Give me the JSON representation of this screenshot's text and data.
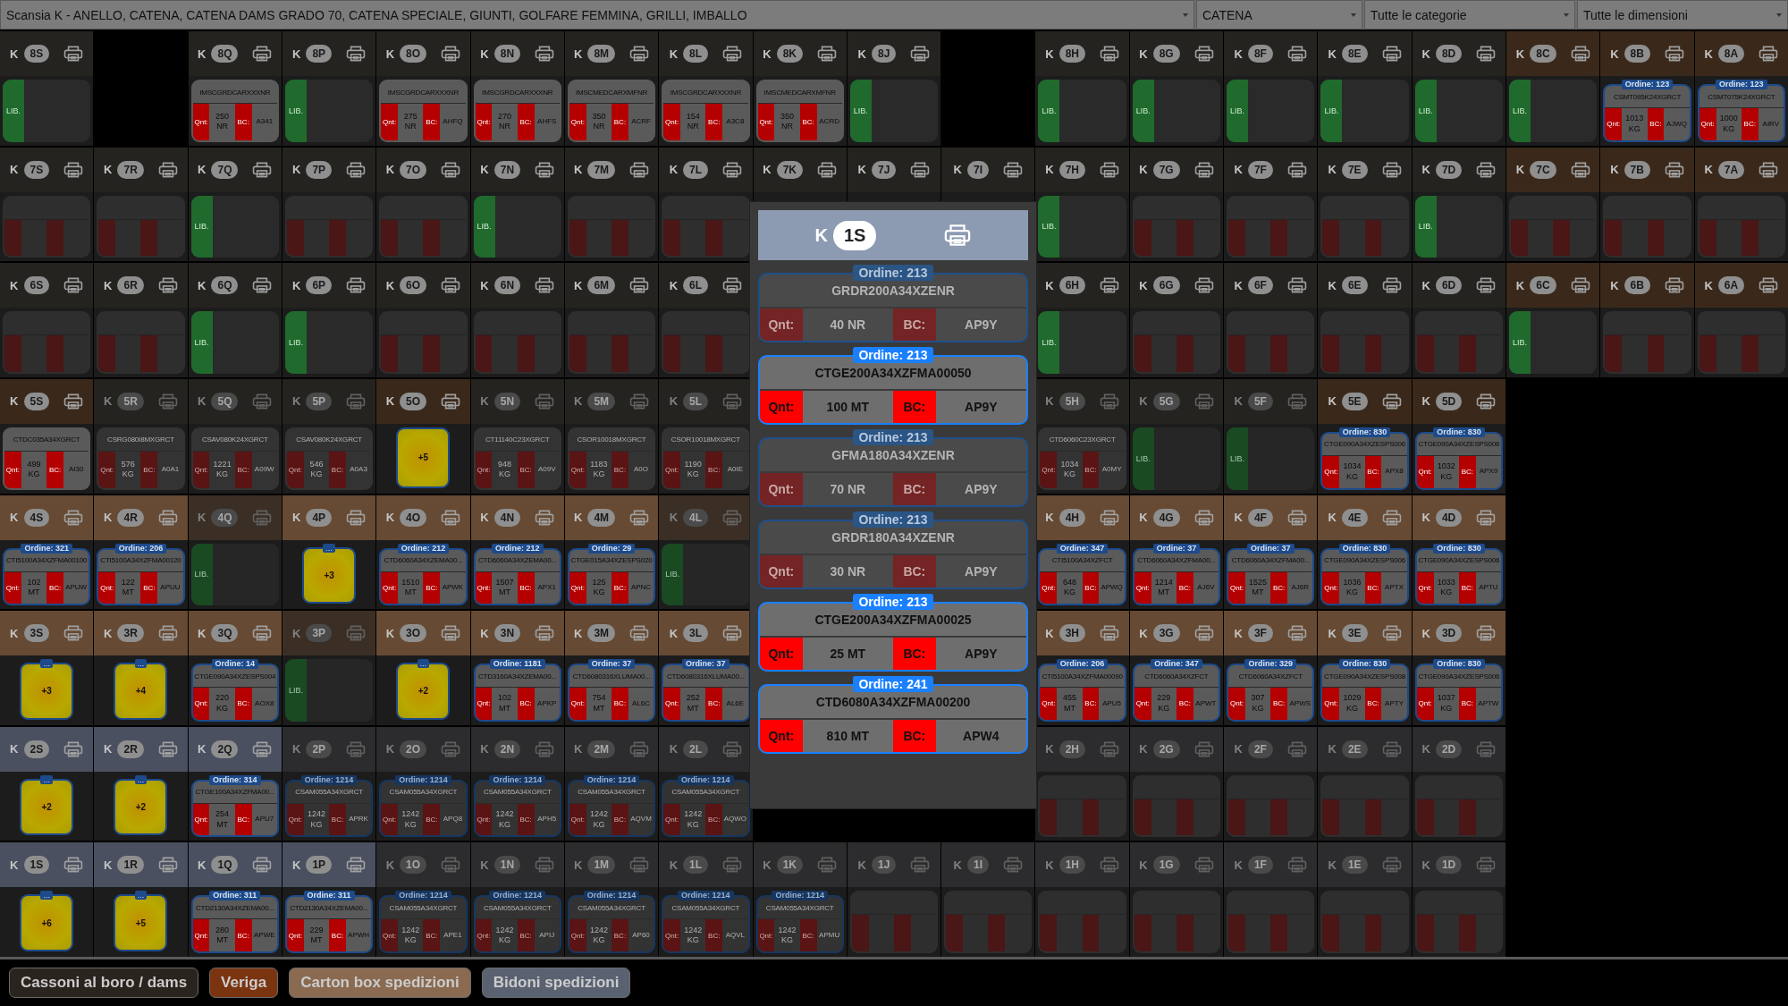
{
  "filters": [
    {
      "kind": "wide",
      "value": "Scansia K - ANELLO, CATENA, CATENA DAMS GRADO 70, CATENA SPECIALE, GIUNTI, GOLFARE FEMMINA, GRILLI, IMBALLO"
    },
    {
      "kind": "narrow",
      "value": "CATENA"
    },
    {
      "kind": "medium",
      "value": "Tutte le categorie"
    },
    {
      "kind": "medium",
      "value": "Tutte le dimensioni"
    }
  ],
  "rows": [
    {
      "cells": [
        {
          "prefix": "K",
          "label": "8S",
          "color": "#252320",
          "disabled": false,
          "kind": "free",
          "text": "LIB."
        },
        {
          "kind": "none"
        },
        {
          "prefix": "K",
          "label": "8Q",
          "color": "#252320",
          "disabled": false,
          "kind": "item",
          "code": "IMSCGRDCARXXXNR",
          "qty_label": "Qnt:",
          "qty": "250 NR",
          "bc_label": "BC:",
          "bc": "A341"
        },
        {
          "prefix": "K",
          "label": "8P",
          "color": "#252320",
          "disabled": false,
          "kind": "free",
          "text": "LIB."
        },
        {
          "prefix": "K",
          "label": "8O",
          "color": "#252320",
          "disabled": false,
          "kind": "item",
          "code": "IMSCGRDCARXXXNR",
          "qty_label": "Qnt:",
          "qty": "275 NR",
          "bc_label": "BC:",
          "bc": "AHFQ"
        },
        {
          "prefix": "K",
          "label": "8N",
          "color": "#252320",
          "disabled": false,
          "kind": "item",
          "code": "IMSCGRDCARXXXNR",
          "qty_label": "Qnt:",
          "qty": "270 NR",
          "bc_label": "BC:",
          "bc": "AHFS"
        },
        {
          "prefix": "K",
          "label": "8M",
          "color": "#252320",
          "disabled": false,
          "kind": "item",
          "code": "IMSCMEDCARXMFNR",
          "qty_label": "Qnt:",
          "qty": "350 NR",
          "bc_label": "BC:",
          "bc": "ACRF"
        },
        {
          "prefix": "K",
          "label": "8L",
          "color": "#252320",
          "disabled": false,
          "kind": "item",
          "code": "IMSCGRDCARXXXNR",
          "qty_label": "Qnt:",
          "qty": "154 NR",
          "bc_label": "BC:",
          "bc": "A3C8"
        },
        {
          "prefix": "K",
          "label": "8K",
          "color": "#252320",
          "disabled": false,
          "kind": "item",
          "code": "IMSCMEDCARXMFNR",
          "qty_label": "Qnt:",
          "qty": "350 NR",
          "bc_label": "BC:",
          "bc": "ACRD"
        },
        {
          "prefix": "K",
          "label": "8J",
          "color": "#252320",
          "disabled": false,
          "kind": "free",
          "text": "LIB."
        },
        {
          "kind": "none"
        },
        {
          "prefix": "K",
          "label": "8H",
          "color": "#252320",
          "disabled": false,
          "kind": "free",
          "text": "LIB."
        },
        {
          "prefix": "K",
          "label": "8G",
          "color": "#252320",
          "disabled": false,
          "kind": "free",
          "text": "LIB."
        },
        {
          "prefix": "K",
          "label": "8F",
          "color": "#252320",
          "disabled": false,
          "kind": "free",
          "text": "LIB."
        },
        {
          "prefix": "K",
          "label": "8E",
          "color": "#252320",
          "disabled": false,
          "kind": "free",
          "text": "LIB."
        },
        {
          "prefix": "K",
          "label": "8D",
          "color": "#252320",
          "disabled": false,
          "kind": "free",
          "text": "LIB."
        },
        {
          "prefix": "K",
          "label": "8C",
          "color": "#3a291b",
          "disabled": false,
          "kind": "free",
          "text": "LIB."
        },
        {
          "prefix": "K",
          "label": "8B",
          "color": "#3a291b",
          "disabled": false,
          "kind": "item",
          "order": "Ordine: 123",
          "code": "CSMT095K24XGRCT",
          "qty_label": "Qnt:",
          "qty": "1013 KG",
          "bc_label": "BC:",
          "bc": "AJWQ"
        },
        {
          "prefix": "K",
          "label": "8A",
          "color": "#3a291b",
          "disabled": false,
          "kind": "item",
          "order": "Ordine: 123",
          "code": "CSMT075K24XGRCT",
          "qty_label": "Qnt:",
          "qty": "1000 KG",
          "bc_label": "BC:",
          "bc": "AIRV"
        }
      ]
    },
    {
      "cells": [
        {
          "prefix": "K",
          "label": "7S",
          "color": "#252320",
          "disabled": false,
          "kind": "blurred"
        },
        {
          "prefix": "K",
          "label": "7R",
          "color": "#252320",
          "disabled": false,
          "kind": "blurred"
        },
        {
          "prefix": "K",
          "label": "7Q",
          "color": "#252320",
          "disabled": false,
          "kind": "free",
          "text": "LIB."
        },
        {
          "prefix": "K",
          "label": "7P",
          "color": "#252320",
          "disabled": false,
          "kind": "blurred"
        },
        {
          "prefix": "K",
          "label": "7O",
          "color": "#252320",
          "disabled": false,
          "kind": "blurred"
        },
        {
          "prefix": "K",
          "label": "7N",
          "color": "#252320",
          "disabled": false,
          "kind": "free",
          "text": "LIB."
        },
        {
          "prefix": "K",
          "label": "7M",
          "color": "#252320",
          "disabled": false,
          "kind": "blurred"
        },
        {
          "prefix": "K",
          "label": "7L",
          "color": "#252320",
          "disabled": false,
          "kind": "blurred"
        },
        {
          "prefix": "K",
          "label": "7K",
          "color": "#252320",
          "disabled": false,
          "kind": "covered"
        },
        {
          "prefix": "K",
          "label": "7J",
          "color": "#252320",
          "disabled": false,
          "kind": "covered"
        },
        {
          "prefix": "K",
          "label": "7I",
          "color": "#252320",
          "disabled": false,
          "kind": "covered"
        },
        {
          "prefix": "K",
          "label": "7H",
          "color": "#252320",
          "disabled": false,
          "kind": "free",
          "text": "LIB."
        },
        {
          "prefix": "K",
          "label": "7G",
          "color": "#252320",
          "disabled": false,
          "kind": "blurred"
        },
        {
          "prefix": "K",
          "label": "7F",
          "color": "#252320",
          "disabled": false,
          "kind": "blurred"
        },
        {
          "prefix": "K",
          "label": "7E",
          "color": "#252320",
          "disabled": false,
          "kind": "blurred"
        },
        {
          "prefix": "K",
          "label": "7D",
          "color": "#252320",
          "disabled": false,
          "kind": "free",
          "text": "LIB."
        },
        {
          "prefix": "K",
          "label": "7C",
          "color": "#3a291b",
          "disabled": false,
          "kind": "blurred"
        },
        {
          "prefix": "K",
          "label": "7B",
          "color": "#3a291b",
          "disabled": false,
          "kind": "blurred"
        },
        {
          "prefix": "K",
          "label": "7A",
          "color": "#3a291b",
          "disabled": false,
          "kind": "blurred"
        }
      ]
    },
    {
      "cells": [
        {
          "prefix": "K",
          "label": "6S",
          "color": "#252320",
          "disabled": false,
          "kind": "blurred"
        },
        {
          "prefix": "K",
          "label": "6R",
          "color": "#252320",
          "disabled": false,
          "kind": "blurred"
        },
        {
          "prefix": "K",
          "label": "6Q",
          "color": "#252320",
          "disabled": false,
          "kind": "free",
          "text": "LIB."
        },
        {
          "prefix": "K",
          "label": "6P",
          "color": "#252320",
          "disabled": false,
          "kind": "free",
          "text": "LIB."
        },
        {
          "prefix": "K",
          "label": "6O",
          "color": "#252320",
          "disabled": false,
          "kind": "blurred"
        },
        {
          "prefix": "K",
          "label": "6N",
          "color": "#252320",
          "disabled": false,
          "kind": "blurred"
        },
        {
          "prefix": "K",
          "label": "6M",
          "color": "#252320",
          "disabled": false,
          "kind": "blurred"
        },
        {
          "prefix": "K",
          "label": "6L",
          "color": "#252320",
          "disabled": false,
          "kind": "blurred"
        },
        {
          "kind": "covered"
        },
        {
          "kind": "covered"
        },
        {
          "kind": "covered"
        },
        {
          "prefix": "K",
          "label": "6H",
          "color": "#252320",
          "disabled": false,
          "kind": "free",
          "text": "LIB."
        },
        {
          "prefix": "K",
          "label": "6G",
          "color": "#252320",
          "disabled": false,
          "kind": "blurred"
        },
        {
          "prefix": "K",
          "label": "6F",
          "color": "#252320",
          "disabled": false,
          "kind": "blurred"
        },
        {
          "prefix": "K",
          "label": "6E",
          "color": "#252320",
          "disabled": false,
          "kind": "blurred"
        },
        {
          "prefix": "K",
          "label": "6D",
          "color": "#252320",
          "disabled": false,
          "kind": "blurred"
        },
        {
          "prefix": "K",
          "label": "6C",
          "color": "#3a291b",
          "disabled": false,
          "kind": "free",
          "text": "LIB."
        },
        {
          "prefix": "K",
          "label": "6B",
          "color": "#3a291b",
          "disabled": false,
          "kind": "blurred"
        },
        {
          "prefix": "K",
          "label": "6A",
          "color": "#3a291b",
          "disabled": false,
          "kind": "blurred"
        }
      ]
    },
    {
      "cells": [
        {
          "prefix": "K",
          "label": "5S",
          "color": "#3a291b",
          "disabled": false,
          "kind": "item",
          "code": "CTDC035A34XGRCT",
          "qty_label": "Qnt:",
          "qty": "499 KG",
          "bc_label": "BC:",
          "bc": "AI30"
        },
        {
          "prefix": "K",
          "label": "5R",
          "color": "#252320",
          "disabled": true,
          "kind": "item",
          "code": "CSRG080I8MXGRCT",
          "qty_label": "Qnt:",
          "qty": "576 KG",
          "bc_label": "BC:",
          "bc": "A0A1"
        },
        {
          "prefix": "K",
          "label": "5Q",
          "color": "#252320",
          "disabled": true,
          "kind": "item",
          "code": "CSAV080K24XGRCT",
          "qty_label": "Qnt:",
          "qty": "1221 KG",
          "bc_label": "BC:",
          "bc": "A09W"
        },
        {
          "prefix": "K",
          "label": "5P",
          "color": "#252320",
          "disabled": true,
          "kind": "item",
          "code": "CSAV080K24XGRCT",
          "qty_label": "Qnt:",
          "qty": "546 KG",
          "bc_label": "BC:",
          "bc": "A0A3"
        },
        {
          "prefix": "K",
          "label": "5O",
          "color": "#3a291b",
          "disabled": false,
          "kind": "stack",
          "count": "+5"
        },
        {
          "prefix": "K",
          "label": "5N",
          "color": "#252320",
          "disabled": true,
          "kind": "item",
          "code": "CT11140C23XGRCT",
          "qty_label": "Qnt:",
          "qty": "948 KG",
          "bc_label": "BC:",
          "bc": "A09V"
        },
        {
          "prefix": "K",
          "label": "5M",
          "color": "#252320",
          "disabled": true,
          "kind": "item",
          "code": "CSOR10018MXGRCT",
          "qty_label": "Qnt:",
          "qty": "1183 KG",
          "bc_label": "BC:",
          "bc": "A0O"
        },
        {
          "prefix": "K",
          "label": "5L",
          "color": "#252320",
          "disabled": true,
          "kind": "item",
          "code": "CSOR10018MXGRCT",
          "qty_label": "Qnt:",
          "qty": "1190 KG",
          "bc_label": "BC:",
          "bc": "A0IE"
        },
        {
          "kind": "covered"
        },
        {
          "kind": "covered"
        },
        {
          "kind": "covered"
        },
        {
          "prefix": "K",
          "label": "5H",
          "color": "#252320",
          "disabled": true,
          "kind": "item",
          "code": "CTD6060C23XGRCT",
          "qty_label": "Qnt:",
          "qty": "1034 KG",
          "bc_label": "BC:",
          "bc": "A0MY"
        },
        {
          "prefix": "K",
          "label": "5G",
          "color": "#252320",
          "disabled": true,
          "kind": "free",
          "text": "LIB."
        },
        {
          "prefix": "K",
          "label": "5F",
          "color": "#252320",
          "disabled": true,
          "kind": "free",
          "text": "LIB."
        },
        {
          "prefix": "K",
          "label": "5E",
          "color": "#3a291b",
          "disabled": false,
          "kind": "item",
          "order": "Ordine: 830",
          "code": "CTGE090A34XZESPS006",
          "qty_label": "Qnt:",
          "qty": "1034 KG",
          "bc_label": "BC:",
          "bc": "APX8"
        },
        {
          "prefix": "K",
          "label": "5D",
          "color": "#3a291b",
          "disabled": false,
          "kind": "item",
          "order": "Ordine: 830",
          "code": "CTGE090A34XZESPS006",
          "qty_label": "Qnt:",
          "qty": "1032 KG",
          "bc_label": "BC:",
          "bc": "APX9"
        }
      ]
    },
    {
      "cells": [
        {
          "prefix": "K",
          "label": "4S",
          "color": "#664a33",
          "disabled": false,
          "kind": "item",
          "order": "Ordine: 321",
          "code": "CTI5100A34XZFMA00100",
          "qty_label": "Qnt:",
          "qty": "102 MT",
          "bc_label": "BC:",
          "bc": "APUW"
        },
        {
          "prefix": "K",
          "label": "4R",
          "color": "#664a33",
          "disabled": false,
          "kind": "item",
          "order": "Ordine: 206",
          "code": "CTI5100A34XZFMA00120",
          "qty_label": "Qnt:",
          "qty": "122 MT",
          "bc_label": "BC:",
          "bc": "APUU"
        },
        {
          "prefix": "K",
          "label": "4Q",
          "color": "#3b2f25",
          "disabled": true,
          "kind": "free",
          "text": "LIB."
        },
        {
          "prefix": "K",
          "label": "4P",
          "color": "#664a33",
          "disabled": false,
          "kind": "stack",
          "badge": "...",
          "count": "+3"
        },
        {
          "prefix": "K",
          "label": "4O",
          "color": "#664a33",
          "disabled": false,
          "kind": "item",
          "order": "Ordine: 212",
          "code": "CTD6060A34XZEMA00...",
          "qty_label": "Qnt:",
          "qty": "1510 MT",
          "bc_label": "BC:",
          "bc": "APWK"
        },
        {
          "prefix": "K",
          "label": "4N",
          "color": "#664a33",
          "disabled": false,
          "kind": "item",
          "order": "Ordine: 212",
          "code": "CTD6060A34XZEMA00...",
          "qty_label": "Qnt:",
          "qty": "1507 MT",
          "bc_label": "BC:",
          "bc": "APX1"
        },
        {
          "prefix": "K",
          "label": "4M",
          "color": "#664a33",
          "disabled": false,
          "kind": "item",
          "order": "Ordine: 29",
          "code": "CTGE015A34XZESPS020",
          "qty_label": "Qnt:",
          "qty": "125 KG",
          "bc_label": "BC:",
          "bc": "APNC"
        },
        {
          "prefix": "K",
          "label": "4L",
          "color": "#3b2f25",
          "disabled": true,
          "kind": "free",
          "text": "LIB."
        },
        {
          "kind": "covered"
        },
        {
          "kind": "covered"
        },
        {
          "kind": "covered"
        },
        {
          "prefix": "K",
          "label": "4H",
          "color": "#664a33",
          "disabled": false,
          "kind": "item",
          "order": "Ordine: 347",
          "code": "CTI5100A34XZFCT",
          "qty_label": "Qnt:",
          "qty": "648 KG",
          "bc_label": "BC:",
          "bc": "APWQ"
        },
        {
          "prefix": "K",
          "label": "4G",
          "color": "#664a33",
          "disabled": false,
          "kind": "item",
          "order": "Ordine: 37",
          "code": "CTD6060A34XZFMA00...",
          "qty_label": "Qnt:",
          "qty": "1214 MT",
          "bc_label": "BC:",
          "bc": "AJ6V"
        },
        {
          "prefix": "K",
          "label": "4F",
          "color": "#664a33",
          "disabled": false,
          "kind": "item",
          "order": "Ordine: 37",
          "code": "CTD6060A34XZFMA00...",
          "qty_label": "Qnt:",
          "qty": "1525 MT",
          "bc_label": "BC:",
          "bc": "AJ6R"
        },
        {
          "prefix": "K",
          "label": "4E",
          "color": "#664a33",
          "disabled": false,
          "kind": "item",
          "order": "Ordine: 830",
          "code": "CTGE090A34XZESPS006",
          "qty_label": "Qnt:",
          "qty": "1036 KG",
          "bc_label": "BC:",
          "bc": "APTX"
        },
        {
          "prefix": "K",
          "label": "4D",
          "color": "#664a33",
          "disabled": false,
          "kind": "item",
          "order": "Ordine: 830",
          "code": "CTGE090A34XZESPS006",
          "qty_label": "Qnt:",
          "qty": "1033 KG",
          "bc_label": "BC:",
          "bc": "APTU"
        }
      ]
    },
    {
      "cells": [
        {
          "prefix": "K",
          "label": "3S",
          "color": "#664a33",
          "disabled": false,
          "kind": "stack",
          "badge": "...",
          "count": "+3"
        },
        {
          "prefix": "K",
          "label": "3R",
          "color": "#664a33",
          "disabled": false,
          "kind": "stack",
          "badge": "...",
          "count": "+4"
        },
        {
          "prefix": "K",
          "label": "3Q",
          "color": "#664a33",
          "disabled": false,
          "kind": "item",
          "order": "Ordine: 14",
          "code": "CTGE090A34XZESPS004",
          "qty_label": "Qnt:",
          "qty": "220 KG",
          "bc_label": "BC:",
          "bc": "AOX8"
        },
        {
          "prefix": "K",
          "label": "3P",
          "color": "#3b2f25",
          "disabled": true,
          "kind": "free",
          "text": "LIB."
        },
        {
          "prefix": "K",
          "label": "3O",
          "color": "#664a33",
          "disabled": false,
          "kind": "stack",
          "badge": "...",
          "count": "+2"
        },
        {
          "prefix": "K",
          "label": "3N",
          "color": "#664a33",
          "disabled": false,
          "kind": "item",
          "order": "Ordine: 1181",
          "code": "CTD3160A34XZEMA00...",
          "qty_label": "Qnt:",
          "qty": "102 MT",
          "bc_label": "BC:",
          "bc": "APKP"
        },
        {
          "prefix": "K",
          "label": "3M",
          "color": "#664a33",
          "disabled": false,
          "kind": "item",
          "order": "Ordine: 37",
          "code": "CTD6080316XLUMA00...",
          "qty_label": "Qnt:",
          "qty": "754 MT",
          "bc_label": "BC:",
          "bc": "AL6C"
        },
        {
          "prefix": "K",
          "label": "3L",
          "color": "#664a33",
          "disabled": false,
          "kind": "item",
          "order": "Ordine: 37",
          "code": "CTD6080316XLUMA00...",
          "qty_label": "Qnt:",
          "qty": "252 MT",
          "bc_label": "BC:",
          "bc": "AL6E"
        },
        {
          "kind": "covered"
        },
        {
          "kind": "covered"
        },
        {
          "kind": "covered"
        },
        {
          "prefix": "K",
          "label": "3H",
          "color": "#664a33",
          "disabled": false,
          "kind": "item",
          "order": "Ordine: 206",
          "code": "CTI5100A34XZFMA00090",
          "qty_label": "Qnt:",
          "qty": "455 MT",
          "bc_label": "BC:",
          "bc": "APU5"
        },
        {
          "prefix": "K",
          "label": "3G",
          "color": "#664a33",
          "disabled": false,
          "kind": "item",
          "order": "Ordine: 347",
          "code": "CTD6060A34XZFCT",
          "qty_label": "Qnt:",
          "qty": "229 KG",
          "bc_label": "BC:",
          "bc": "APWT"
        },
        {
          "prefix": "K",
          "label": "3F",
          "color": "#664a33",
          "disabled": false,
          "kind": "item",
          "order": "Ordine: 329",
          "code": "CTD6060A34XZFCT",
          "qty_label": "Qnt:",
          "qty": "307 KG",
          "bc_label": "BC:",
          "bc": "APWS"
        },
        {
          "prefix": "K",
          "label": "3E",
          "color": "#664a33",
          "disabled": false,
          "kind": "item",
          "order": "Ordine: 830",
          "code": "CTGE090A34XZESPS008",
          "qty_label": "Qnt:",
          "qty": "1029 KG",
          "bc_label": "BC:",
          "bc": "APTY"
        },
        {
          "prefix": "K",
          "label": "3D",
          "color": "#664a33",
          "disabled": false,
          "kind": "item",
          "order": "Ordine: 830",
          "code": "CTGE090A34XZESPS006",
          "qty_label": "Qnt:",
          "qty": "1037 KG",
          "bc_label": "BC:",
          "bc": "APTW"
        }
      ]
    },
    {
      "cells": [
        {
          "prefix": "K",
          "label": "2S",
          "color": "#4a5060",
          "disabled": false,
          "kind": "stack",
          "badge": "...",
          "count": "+2"
        },
        {
          "prefix": "K",
          "label": "2R",
          "color": "#4a5060",
          "disabled": false,
          "kind": "stack",
          "badge": "...",
          "count": "+2"
        },
        {
          "prefix": "K",
          "label": "2Q",
          "color": "#4a5060",
          "disabled": false,
          "kind": "item",
          "order": "Ordine: 314",
          "code": "CTGE100A34XZFMA00...",
          "qty_label": "Qnt:",
          "qty": "254 MT",
          "bc_label": "BC:",
          "bc": "APU7"
        },
        {
          "prefix": "K",
          "label": "2P",
          "color": "#2c2c2e",
          "disabled": true,
          "kind": "item",
          "order": "Ordine: 1214",
          "code": "CSAM055A34XGRCT",
          "qty_label": "Qnt:",
          "qty": "1242 KG",
          "bc_label": "BC:",
          "bc": "APRK"
        },
        {
          "prefix": "K",
          "label": "2O",
          "color": "#2c2c2e",
          "disabled": true,
          "kind": "item",
          "order": "Ordine: 1214",
          "code": "CSAM055A34XGRCT",
          "qty_label": "Qnt:",
          "qty": "1242 KG",
          "bc_label": "BC:",
          "bc": "APQ8"
        },
        {
          "prefix": "K",
          "label": "2N",
          "color": "#2c2c2e",
          "disabled": true,
          "kind": "item",
          "order": "Ordine: 1214",
          "code": "CSAM055A34XGRCT",
          "qty_label": "Qnt:",
          "qty": "1242 KG",
          "bc_label": "BC:",
          "bc": "APH5"
        },
        {
          "prefix": "K",
          "label": "2M",
          "color": "#2c2c2e",
          "disabled": true,
          "kind": "item",
          "order": "Ordine: 1214",
          "code": "CSAM055A34XGRCT",
          "qty_label": "Qnt:",
          "qty": "1242 KG",
          "bc_label": "BC:",
          "bc": "AQVM"
        },
        {
          "prefix": "K",
          "label": "2L",
          "color": "#2c2c2e",
          "disabled": true,
          "kind": "item",
          "order": "Ordine: 1214",
          "code": "CSAM055A34XGRCT",
          "qty_label": "Qnt:",
          "qty": "1242 KG",
          "bc_label": "BC:",
          "bc": "AQWO"
        },
        {
          "kind": "covered"
        },
        {
          "kind": "covered"
        },
        {
          "kind": "covered"
        },
        {
          "prefix": "K",
          "label": "2H",
          "color": "#2c2c2e",
          "disabled": true,
          "kind": "blurred"
        },
        {
          "prefix": "K",
          "label": "2G",
          "color": "#2c2c2e",
          "disabled": true,
          "kind": "blurred"
        },
        {
          "prefix": "K",
          "label": "2F",
          "color": "#2c2c2e",
          "disabled": true,
          "kind": "blurred"
        },
        {
          "prefix": "K",
          "label": "2E",
          "color": "#2c2c2e",
          "disabled": true,
          "kind": "blurred"
        },
        {
          "prefix": "K",
          "label": "2D",
          "color": "#2c2c2e",
          "disabled": true,
          "kind": "blurred"
        }
      ]
    },
    {
      "cells": [
        {
          "prefix": "K",
          "label": "1S",
          "color": "#4a5060",
          "disabled": false,
          "kind": "stack",
          "badge": "...",
          "count": "+6"
        },
        {
          "prefix": "K",
          "label": "1R",
          "color": "#4a5060",
          "disabled": false,
          "kind": "stack",
          "badge": "...",
          "count": "+5"
        },
        {
          "prefix": "K",
          "label": "1Q",
          "color": "#4a5060",
          "disabled": false,
          "kind": "item",
          "order": "Ordine: 311",
          "code": "CTD2130A34XZEMA00...",
          "qty_label": "Qnt:",
          "qty": "280 MT",
          "bc_label": "BC:",
          "bc": "APWE"
        },
        {
          "prefix": "K",
          "label": "1P",
          "color": "#4a5060",
          "disabled": false,
          "kind": "item",
          "order": "Ordine: 311",
          "code": "CTD2130A34XZEMA00...",
          "qty_label": "Qnt:",
          "qty": "229 MT",
          "bc_label": "BC:",
          "bc": "APWH"
        },
        {
          "prefix": "K",
          "label": "1O",
          "color": "#2c2c2e",
          "disabled": true,
          "kind": "item",
          "order": "Ordine: 1214",
          "code": "CSAM055A34XGRCT",
          "qty_label": "Qnt:",
          "qty": "1242 KG",
          "bc_label": "BC:",
          "bc": "APE1"
        },
        {
          "prefix": "K",
          "label": "1N",
          "color": "#2c2c2e",
          "disabled": true,
          "kind": "item",
          "order": "Ordine: 1214",
          "code": "CSAM055A34XGRCT",
          "qty_label": "Qnt:",
          "qty": "1242 KG",
          "bc_label": "BC:",
          "bc": "APIJ"
        },
        {
          "prefix": "K",
          "label": "1M",
          "color": "#2c2c2e",
          "disabled": true,
          "kind": "item",
          "order": "Ordine: 1214",
          "code": "CSAM055A34XGRCT",
          "qty_label": "Qnt:",
          "qty": "1242 KG",
          "bc_label": "BC:",
          "bc": "AP60"
        },
        {
          "prefix": "K",
          "label": "1L",
          "color": "#2c2c2e",
          "disabled": true,
          "kind": "item",
          "order": "Ordine: 1214",
          "code": "CSAM055A34XGRCT",
          "qty_label": "Qnt:",
          "qty": "1242 KG",
          "bc_label": "BC:",
          "bc": "AQVL"
        },
        {
          "prefix": "K",
          "label": "1K",
          "color": "#2c2c2e",
          "disabled": true,
          "kind": "item",
          "order": "Ordine: 1214",
          "code": "CSAM055A34XGRCT",
          "qty_label": "Qnt:",
          "qty": "1242 KG",
          "bc_label": "BC:",
          "bc": "APMU"
        },
        {
          "prefix": "K",
          "label": "1J",
          "color": "#2c2c2e",
          "disabled": true,
          "kind": "blurred"
        },
        {
          "prefix": "K",
          "label": "1I",
          "color": "#2c2c2e",
          "disabled": true,
          "kind": "blurred"
        },
        {
          "prefix": "K",
          "label": "1H",
          "color": "#2c2c2e",
          "disabled": true,
          "kind": "blurred"
        },
        {
          "prefix": "K",
          "label": "1G",
          "color": "#2c2c2e",
          "disabled": true,
          "kind": "blurred"
        },
        {
          "prefix": "K",
          "label": "1F",
          "color": "#2c2c2e",
          "disabled": true,
          "kind": "blurred"
        },
        {
          "prefix": "K",
          "label": "1E",
          "color": "#2c2c2e",
          "disabled": true,
          "kind": "blurred"
        },
        {
          "prefix": "K",
          "label": "1D",
          "color": "#2c2c2e",
          "disabled": true,
          "kind": "blurred"
        }
      ]
    }
  ],
  "popup": {
    "prefix": "K",
    "label": "1S",
    "entries": [
      {
        "disabled": true,
        "order": "Ordine: 213",
        "code": "GRDR200A34XZENR",
        "qty_label": "Qnt:",
        "qty": "40 NR",
        "bc_label": "BC:",
        "bc": "AP9Y"
      },
      {
        "disabled": false,
        "order": "Ordine: 213",
        "code": "CTGE200A34XZFMA00050",
        "qty_label": "Qnt:",
        "qty": "100 MT",
        "bc_label": "BC:",
        "bc": "AP9Y"
      },
      {
        "disabled": true,
        "order": "Ordine: 213",
        "code": "GFMA180A34XZENR",
        "qty_label": "Qnt:",
        "qty": "70 NR",
        "bc_label": "BC:",
        "bc": "AP9Y"
      },
      {
        "disabled": true,
        "order": "Ordine: 213",
        "code": "GRDR180A34XZENR",
        "qty_label": "Qnt:",
        "qty": "30 NR",
        "bc_label": "BC:",
        "bc": "AP9Y"
      },
      {
        "disabled": false,
        "order": "Ordine: 213",
        "code": "CTGE200A34XZFMA00025",
        "qty_label": "Qnt:",
        "qty": "25 MT",
        "bc_label": "BC:",
        "bc": "AP9Y"
      },
      {
        "disabled": false,
        "order": "Ordine: 241",
        "code": "CTD6080A34XZFMA00200",
        "qty_label": "Qnt:",
        "qty": "810 MT",
        "bc_label": "BC:",
        "bc": "APW4"
      }
    ]
  },
  "footer_buttons": [
    {
      "label": "Cassoni al boro / dams",
      "color": "#2a241e"
    },
    {
      "label": "Veriga",
      "color": "#7a3410"
    },
    {
      "label": "Carton box spedizioni",
      "color": "#8a6a50"
    },
    {
      "label": "Bidoni spedizioni",
      "color": "#5a6272"
    }
  ]
}
